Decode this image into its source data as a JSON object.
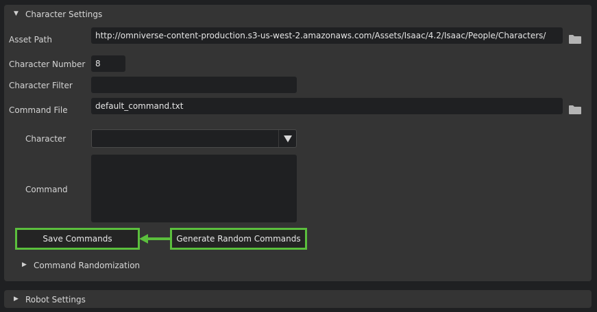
{
  "character_settings": {
    "header": "Character Settings",
    "asset_path": {
      "label": "Asset Path",
      "value": "http://omniverse-content-production.s3-us-west-2.amazonaws.com/Assets/Isaac/4.2/Isaac/People/Characters/"
    },
    "character_number": {
      "label": "Character Number",
      "value": "8"
    },
    "character_filter": {
      "label": "Character Filter",
      "value": ""
    },
    "command_file": {
      "label": "Command File",
      "value": "default_command.txt"
    },
    "character": {
      "label": "Character",
      "selected": ""
    },
    "command": {
      "label": "Command",
      "value": ""
    },
    "buttons": {
      "save": "Save Commands",
      "generate": "Generate Random Commands"
    },
    "command_randomization": {
      "label": "Command Randomization"
    }
  },
  "robot_settings": {
    "header": "Robot Settings"
  },
  "colors": {
    "highlight": "#5bbf3d",
    "panel": "#343434",
    "field": "#1f2022"
  }
}
